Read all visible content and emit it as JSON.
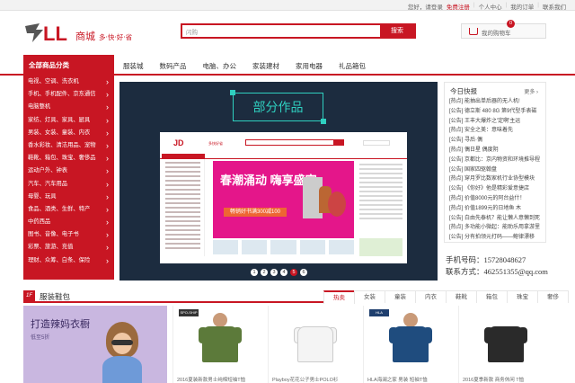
{
  "topbar": {
    "links": [
      "您好，请登录",
      "免费注册",
      "个人中心",
      "我的订单",
      "联系我们"
    ]
  },
  "logo": {
    "brand": "LL",
    "name": "商城",
    "slogan": "多·快·好·省"
  },
  "search": {
    "value": "闪购",
    "button": "搜索"
  },
  "cart": {
    "label": "我的购物车",
    "count": "0"
  },
  "nav": {
    "all_categories": "全部商品分类",
    "links": [
      "服装城",
      "数码产品",
      "电脑、办公",
      "家装建材",
      "家用电器",
      "礼品箱包"
    ]
  },
  "categories": [
    "电视、空调、洗衣机",
    "手机、手机配件、京东通信",
    "电脑整机",
    "家纺、灯具、家具、厨具",
    "男装、女装、童装、内衣",
    "香水彩妆、清洁用品、宠物",
    "鞋靴、箱包、珠宝、奢侈品",
    "运动户外、钟表",
    "汽车、汽车用品",
    "母婴、玩具",
    "食品、酒类、生鲜、特产",
    "中药西品",
    "图书、音像、电子书",
    "彩票、旅游、充值",
    "理财、众筹、白条、保险"
  ],
  "banner": {
    "tag": "部分作品",
    "preview_logo": "JD",
    "preview_sub": "多快好省",
    "preview_headline": "春潮涌动 嗨享盛宴",
    "preview_deal": "畅销好书满300减100",
    "dots": [
      "1",
      "2",
      "3",
      "4",
      "5",
      "6"
    ],
    "active_dot": 5
  },
  "news": {
    "title": "今日快报",
    "more": "更多 ›",
    "items": [
      "[热点] 能抽出单后器的无人机!",
      "[公告] 德立斯 480 8G 第9代型手表磁",
      "[公告] 王丰大爆炸之'定啊'主运",
      "[热点] 安全之美：意味着先",
      "[公告] 寻后·偶",
      "[热点] 偶日星 偶度阴",
      "[公告] 京都比：京内物资和环境推导程",
      "[公告] 国家四驱翰盘",
      "[热点] 穿月罗比数家机行业协型模块",
      "[公告] 《你好》他是精彩爱意捷店",
      "[热点] 价值8000元的阿台益什！",
      "[热点] 价值1899元的日地鱼 木",
      "[公告] 白由先泰机？能让懒人意懒到死",
      "[热点] 多功能小微起：能助乐用拿游里",
      "[公告] 分有拍领元打码——鲍律漂移"
    ]
  },
  "contact": {
    "phone_label": "手机号码：",
    "phone": "15728048627",
    "qq_label": "联系方式：",
    "qq": "462551355@qq.com"
  },
  "floor": {
    "number": "1F",
    "title": "服装鞋包",
    "tabs": [
      "热卖",
      "女装",
      "童装",
      "内衣",
      "鞋靴",
      "箱包",
      "珠宝",
      "奢侈"
    ],
    "active_tab": 0
  },
  "promo": {
    "title": "打造辣妈衣橱",
    "subtitle": "低至5折"
  },
  "products": [
    {
      "label": "2016夏装新款男士纯棉短袖T恤",
      "color": "#5c7a3a",
      "badge": "SPO-SHIP"
    },
    {
      "label": "Playboy花花公子男士POLO衫",
      "color": "#f4f4f4",
      "badge": ""
    },
    {
      "label": "HLA海澜之家 男装 短袖T恤",
      "color": "#1f4c7e",
      "badge": "HLA"
    },
    {
      "label": "2016夏季新款 商务休闲 T恤",
      "color": "#2a2a2a",
      "badge": ""
    }
  ]
}
